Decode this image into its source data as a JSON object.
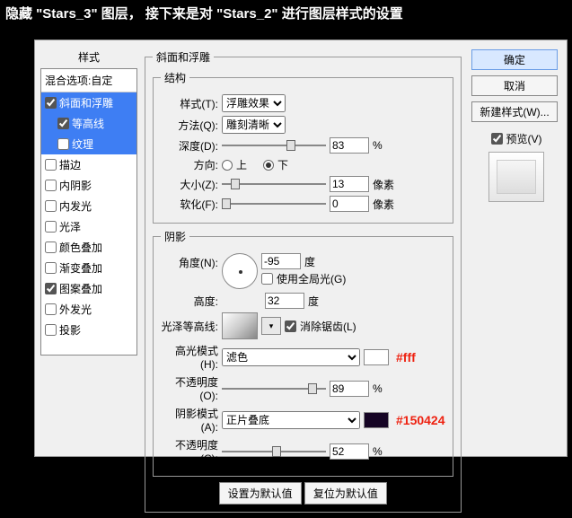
{
  "caption": "隐藏 \"Stars_3\" 图层，  接下来是对 \"Stars_2\" 进行图层样式的设置",
  "ui": {
    "styles_title": "样式",
    "blend_opts": "混合选项:自定",
    "effects": [
      {
        "label": "斜面和浮雕",
        "checked": true,
        "sel": true
      },
      {
        "label": "等高线",
        "checked": true,
        "sel": true,
        "sub": true
      },
      {
        "label": "纹理",
        "checked": false,
        "sel": true,
        "sub": true
      },
      {
        "label": "描边",
        "checked": false
      },
      {
        "label": "内阴影",
        "checked": false
      },
      {
        "label": "内发光",
        "checked": false
      },
      {
        "label": "光泽",
        "checked": false
      },
      {
        "label": "颜色叠加",
        "checked": false
      },
      {
        "label": "渐变叠加",
        "checked": false
      },
      {
        "label": "图案叠加",
        "checked": true
      },
      {
        "label": "外发光",
        "checked": false
      },
      {
        "label": "投影",
        "checked": false
      }
    ],
    "bevel_legend": "斜面和浮雕",
    "struct_legend": "结构",
    "shade_legend": "阴影",
    "style_lbl": "样式(T):",
    "style_val": "浮雕效果",
    "tech_lbl": "方法(Q):",
    "tech_val": "雕刻清晰",
    "depth_lbl": "深度(D):",
    "depth_val": "83",
    "pct": "%",
    "dir_lbl": "方向:",
    "dir_up": "上",
    "dir_down": "下",
    "size_lbl": "大小(Z):",
    "size_val": "13",
    "px": "像素",
    "soft_lbl": "软化(F):",
    "soft_val": "0",
    "angle_lbl": "角度(N):",
    "angle_val": "-95",
    "deg": "度",
    "global_light": "使用全局光(G)",
    "alt_lbl": "高度:",
    "alt_val": "32",
    "gloss_lbl": "光泽等高线:",
    "antialias": "消除锯齿(L)",
    "hmode_lbl": "高光模式(H):",
    "hmode_val": "滤色",
    "hcolor": "#fff",
    "hcolor_hex": "#fff",
    "hopacity_lbl": "不透明度(O):",
    "hopacity_val": "89",
    "smode_lbl": "阴影模式(A):",
    "smode_val": "正片叠底",
    "scolor": "#150424",
    "scolor_hex": "#150424",
    "sopacity_lbl": "不透明度(C):",
    "sopacity_val": "52",
    "btn_default": "设置为默认值",
    "btn_reset": "复位为默认值",
    "ok": "确定",
    "cancel": "取消",
    "new_style": "新建样式(W)...",
    "preview": "预览(V)"
  }
}
